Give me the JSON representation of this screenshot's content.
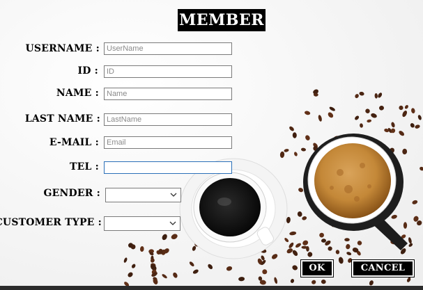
{
  "form": {
    "title": "MEMBER",
    "fields": {
      "username": {
        "label": "USERNAME :",
        "placeholder": "UserName",
        "value": ""
      },
      "id": {
        "label": "ID :",
        "placeholder": "ID",
        "value": ""
      },
      "name": {
        "label": "NAME :",
        "placeholder": "Name",
        "value": ""
      },
      "last_name": {
        "label": "LAST NAME :",
        "placeholder": "LastName",
        "value": ""
      },
      "email": {
        "label": "E-MAIL :",
        "placeholder": "Email",
        "value": ""
      },
      "tel": {
        "label": "TEL :",
        "placeholder": "",
        "value": ""
      }
    },
    "gender": {
      "label": "GENDER :",
      "selected": ""
    },
    "customer_type": {
      "label": "CUSTOMER TYPE :",
      "selected": ""
    },
    "buttons": {
      "ok": "OK",
      "cancel": "CANCEL"
    }
  },
  "colors": {
    "title_bg": "#000000",
    "button_bg": "#000000",
    "focus_border": "#2a6fb8",
    "background": "#f7f7f7"
  }
}
